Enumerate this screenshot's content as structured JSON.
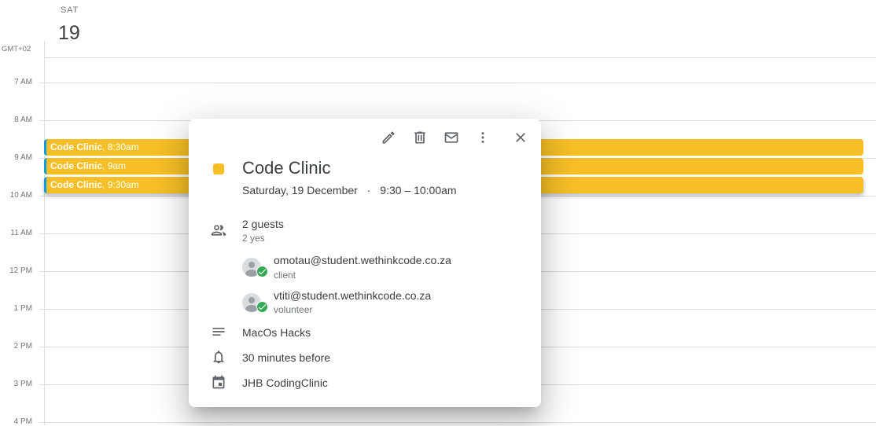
{
  "header": {
    "day_name": "SAT",
    "day_number": "19",
    "timezone": "GMT+02"
  },
  "hours": [
    "7 AM",
    "8 AM",
    "9 AM",
    "10 AM",
    "11 AM",
    "12 PM",
    "1 PM",
    "2 PM",
    "3 PM",
    "4 PM"
  ],
  "events": [
    {
      "title": "Code Clinic",
      "time": "8:30am"
    },
    {
      "title": "Code Clinic",
      "time": "9am"
    },
    {
      "title": "Code Clinic",
      "time": "9:30am"
    }
  ],
  "colors": {
    "event": "#f6bf26",
    "event_border": "#039be5",
    "guest_check": "#34a853"
  },
  "popover": {
    "toolbar": {
      "edit": "edit-icon",
      "delete": "trash-icon",
      "email": "mail-icon",
      "more": "more-vert-icon",
      "close": "close-icon"
    },
    "title": "Code Clinic",
    "date": "Saturday, 19 December",
    "separator": "·",
    "time": "9:30 – 10:00am",
    "guests_summary": "2 guests",
    "guests_responses": "2 yes",
    "guests": [
      {
        "email": "omotau@student.wethinkcode.co.za",
        "role": "client"
      },
      {
        "email": "vtiti@student.wethinkcode.co.za",
        "role": "volunteer"
      }
    ],
    "description": "MacOs Hacks",
    "reminder": "30 minutes before",
    "calendar": "JHB CodingClinic"
  }
}
